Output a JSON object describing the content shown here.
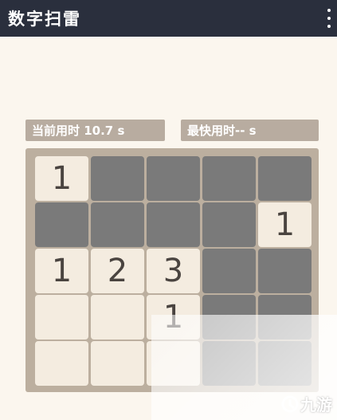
{
  "app": {
    "title": "数字扫雷",
    "menu_icon": "more-vert-icon"
  },
  "stats": {
    "time_label": "当前用时 10.7 s",
    "best_label": "最快用时-- s"
  },
  "board": {
    "rows": 5,
    "cols": 5,
    "cells": [
      [
        {
          "state": "open",
          "value": "1"
        },
        {
          "state": "covered",
          "value": ""
        },
        {
          "state": "covered",
          "value": ""
        },
        {
          "state": "covered",
          "value": ""
        },
        {
          "state": "covered",
          "value": ""
        }
      ],
      [
        {
          "state": "covered",
          "value": ""
        },
        {
          "state": "covered",
          "value": ""
        },
        {
          "state": "covered",
          "value": ""
        },
        {
          "state": "covered",
          "value": ""
        },
        {
          "state": "open",
          "value": "1"
        }
      ],
      [
        {
          "state": "open",
          "value": "1"
        },
        {
          "state": "open",
          "value": "2"
        },
        {
          "state": "open",
          "value": "3"
        },
        {
          "state": "covered",
          "value": ""
        },
        {
          "state": "covered",
          "value": ""
        }
      ],
      [
        {
          "state": "open",
          "value": ""
        },
        {
          "state": "open",
          "value": ""
        },
        {
          "state": "open",
          "value": "1"
        },
        {
          "state": "covered",
          "value": ""
        },
        {
          "state": "covered",
          "value": ""
        }
      ],
      [
        {
          "state": "open",
          "value": ""
        },
        {
          "state": "open",
          "value": ""
        },
        {
          "state": "open",
          "value": ""
        },
        {
          "state": "covered",
          "value": ""
        },
        {
          "state": "covered",
          "value": ""
        }
      ]
    ]
  },
  "watermark": {
    "text": "九游",
    "icon": "jiuyou-logo-icon"
  }
}
